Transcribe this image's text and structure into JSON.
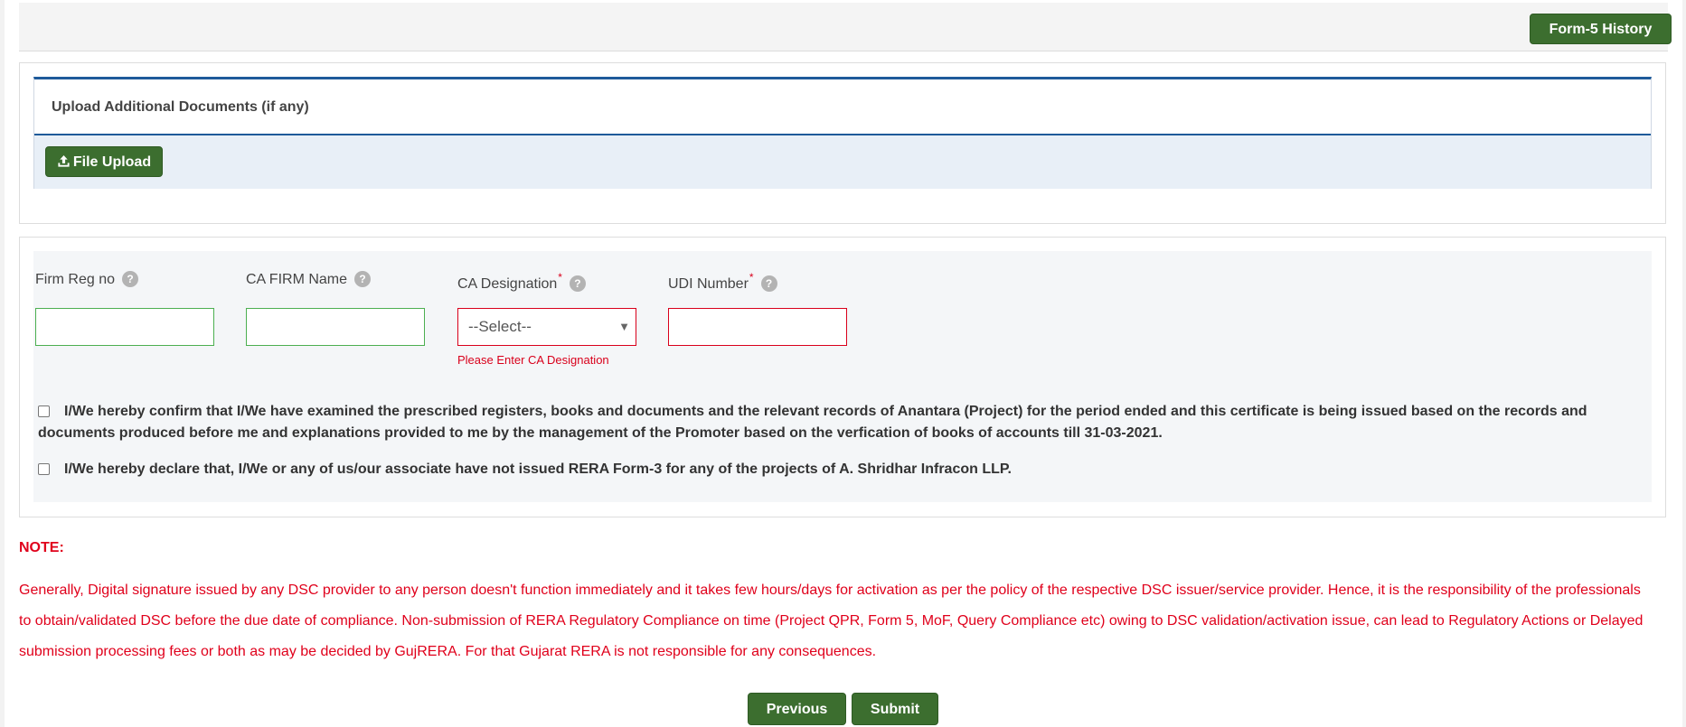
{
  "header": {
    "history_button": "Form-5 History"
  },
  "upload": {
    "title": "Upload Additional Documents (if any)",
    "button_label": "File Upload"
  },
  "fields": {
    "firm_reg_no": {
      "label": "Firm Reg no",
      "value": ""
    },
    "ca_firm_name": {
      "label": "CA FIRM Name",
      "value": ""
    },
    "ca_designation": {
      "label": "CA Designation",
      "selected": "--Select--",
      "error": "Please Enter CA Designation"
    },
    "udi_number": {
      "label": "UDI Number",
      "value": ""
    },
    "required_marker": "*",
    "help_glyph": "?"
  },
  "declarations": {
    "confirm": "I/We hereby confirm that I/We have examined the prescribed registers, books and documents and the relevant records of Anantara (Project) for the period ended and this certificate is being issued based on the records and documents produced before me and explanations provided to me by the management of the Promoter based on the verfication of books of accounts till 31-03-2021.",
    "declare": "I/We hereby declare that, I/We or any of us/our associate have not issued RERA Form-3 for any of the projects of A. Shridhar Infracon LLP."
  },
  "note": {
    "title": "NOTE:",
    "text": "Generally, Digital signature issued by any DSC provider to any person doesn't function immediately and it takes few hours/days for activation as per the policy of the respective DSC issuer/service provider. Hence, it is the responsibility of the professionals to obtain/validated DSC before the due date of compliance. Non-submission of RERA Regulatory Compliance on time (Project QPR, Form 5, MoF, Query Compliance etc) owing to DSC validation/activation issue, can lead to Regulatory Actions or Delayed submission processing fees or both as may be decided by GujRERA. For that Gujarat RERA is not responsible for any consequences."
  },
  "actions": {
    "previous": "Previous",
    "submit": "Submit"
  },
  "icons": {
    "upload": "upload-icon",
    "help": "help-icon",
    "dropdown": "dropdown-arrow-icon"
  },
  "colors": {
    "primary_button": "#3c6e2f",
    "panel_accent": "#1e5a9a",
    "error": "#d9001b",
    "note": "#e0001b"
  }
}
